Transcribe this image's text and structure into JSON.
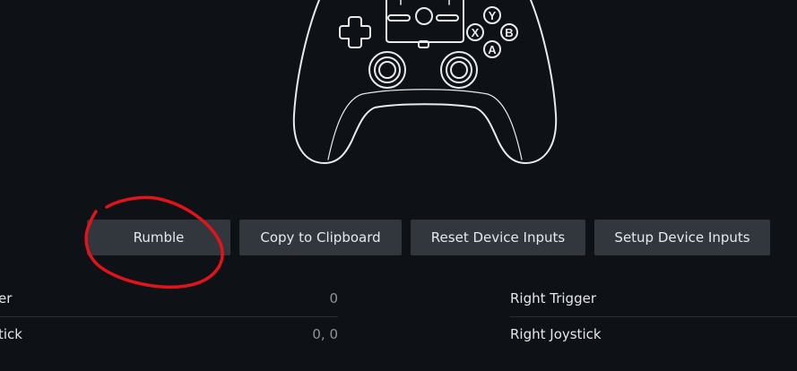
{
  "controller": {
    "face_buttons": [
      "Y",
      "X",
      "B",
      "A"
    ]
  },
  "actions": {
    "rumble_label": "Rumble",
    "copy_label": "Copy to Clipboard",
    "reset_label": "Reset Device Inputs",
    "setup_label": "Setup Device Inputs"
  },
  "inputs": {
    "left": [
      {
        "label": "er",
        "value": "0"
      },
      {
        "label": "tick",
        "value": "0, 0"
      }
    ],
    "right": [
      {
        "label": "Right Trigger",
        "value": ""
      },
      {
        "label": "Right Joystick",
        "value": ""
      }
    ]
  },
  "colors": {
    "background": "#0e1116",
    "button": "#32363d",
    "annotation": "#e0141a"
  }
}
